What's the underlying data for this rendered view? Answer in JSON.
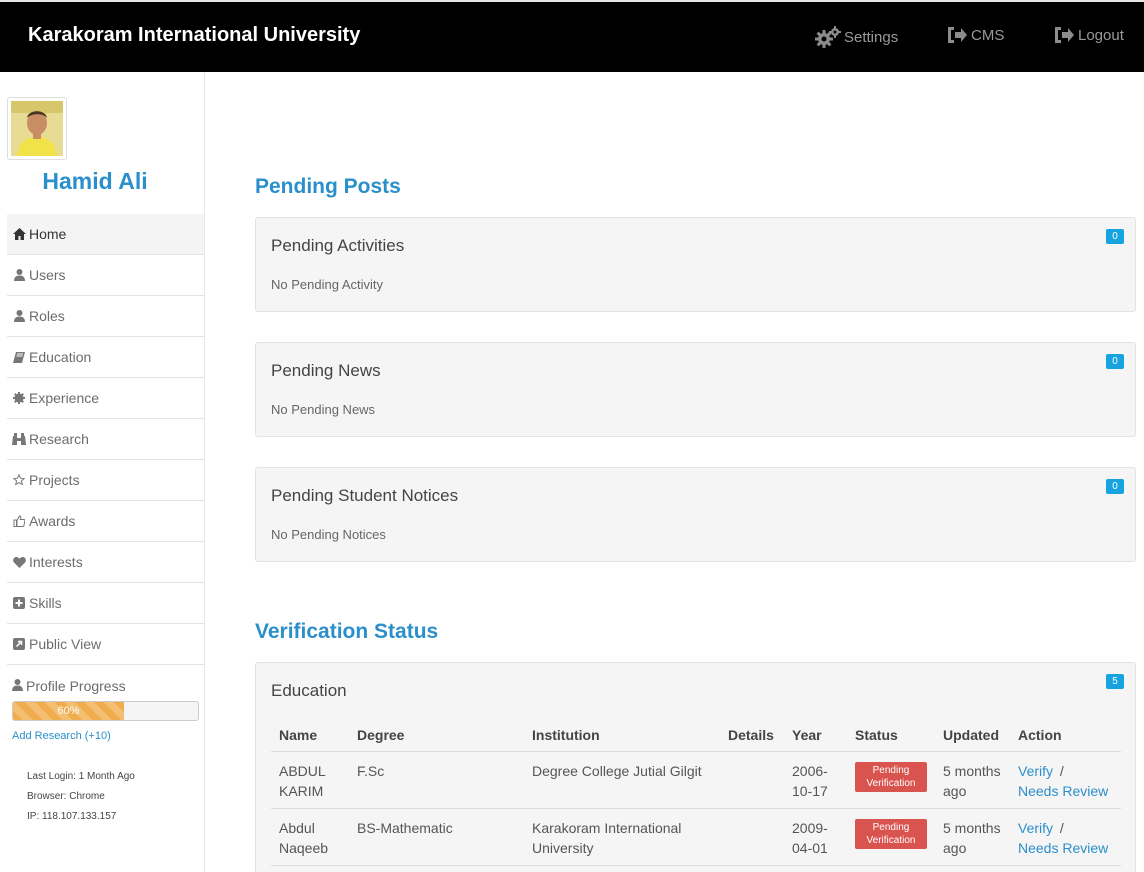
{
  "navbar": {
    "brand": "Karakoram International University",
    "settings": "Settings",
    "cms": "CMS",
    "logout": "Logout"
  },
  "profile": {
    "name": "Hamid Ali"
  },
  "menu": {
    "items": [
      {
        "label": "Home",
        "icon": "home-icon"
      },
      {
        "label": "Users",
        "icon": "user-icon"
      },
      {
        "label": "Roles",
        "icon": "user-icon"
      },
      {
        "label": "Education",
        "icon": "book-icon"
      },
      {
        "label": "Experience",
        "icon": "certificate-icon"
      },
      {
        "label": "Research",
        "icon": "binoculars-icon"
      },
      {
        "label": "Projects",
        "icon": "star-icon"
      },
      {
        "label": "Awards",
        "icon": "thumbs-up-icon"
      },
      {
        "label": "Interests",
        "icon": "heart-icon"
      },
      {
        "label": "Skills",
        "icon": "plus-square-icon"
      },
      {
        "label": "Public View",
        "icon": "external-link-icon"
      }
    ],
    "active": "Home"
  },
  "progress": {
    "label": "Profile Progress",
    "value_text": "60%",
    "value": 60,
    "add_research": "Add Research (+10)"
  },
  "login_info": {
    "last_login": "Last Login: 1 Month Ago",
    "browser": "Browser: Chrome",
    "ip": "IP: 118.107.133.157"
  },
  "pending": {
    "title": "Pending Posts",
    "panels": [
      {
        "title": "Pending Activities",
        "text": "No Pending Activity",
        "count": "0"
      },
      {
        "title": "Pending News",
        "text": "No Pending News",
        "count": "0"
      },
      {
        "title": "Pending Student Notices",
        "text": "No Pending Notices",
        "count": "0"
      }
    ]
  },
  "verification": {
    "title": "Verification Status",
    "education": {
      "title": "Education",
      "count": "5",
      "headers": [
        "Name",
        "Degree",
        "Institution",
        "Details",
        "Year",
        "Status",
        "Updated",
        "Action"
      ],
      "rows": [
        {
          "name": "ABDUL KARIM",
          "degree": "F.Sc",
          "institution": "Degree College Jutial Gilgit",
          "details": "",
          "year": "2006-10-17",
          "status": "Pending Verification",
          "updated": "5 months ago",
          "verify": "Verify",
          "sep": "/",
          "review": "Needs Review"
        },
        {
          "name": "Abdul Naqeeb",
          "degree": "BS-Mathematic",
          "institution": "Karakoram International University",
          "details": "",
          "year": "2009-04-01",
          "status": "Pending Verification",
          "updated": "5 months ago",
          "verify": "Verify",
          "sep": "/",
          "review": "Needs Review"
        }
      ]
    }
  },
  "colors": {
    "accent": "#2a8fca",
    "badge": "#17a2e0",
    "status_pending": "#d9534f",
    "progress": "#f0ad4e"
  }
}
